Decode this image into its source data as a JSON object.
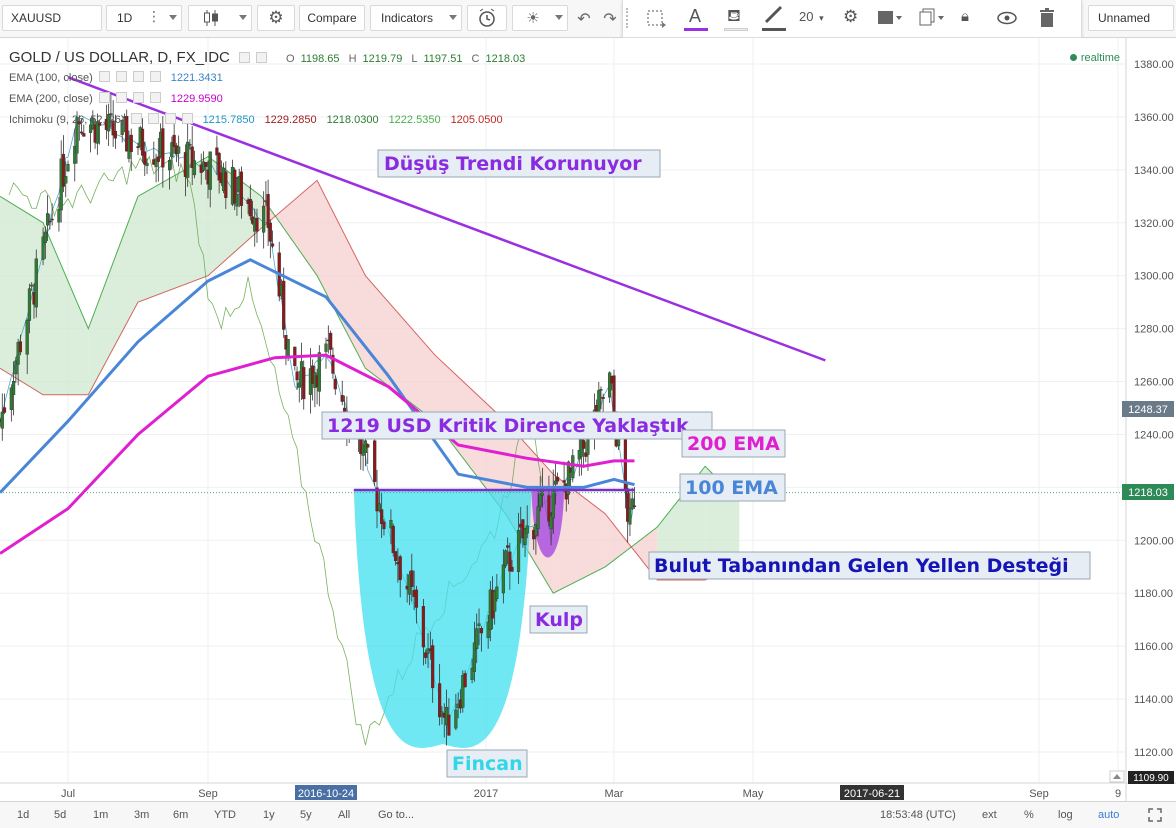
{
  "toolbar": {
    "symbol": "XAUUSD",
    "interval": "1D",
    "compare_label": "Compare",
    "indicators_label": "Indicators",
    "zoom_label": "20",
    "layout_name": "Unnamed"
  },
  "legend": {
    "title": "GOLD / US DOLLAR, D, FX_IDC",
    "ohlc": {
      "o_label": "O",
      "o": "1198.65",
      "h_label": "H",
      "h": "1219.79",
      "l_label": "L",
      "l": "1197.51",
      "c_label": "C",
      "c": "1218.03"
    },
    "realtime": "realtime",
    "indicators": [
      {
        "name": "EMA (100, close)",
        "values": [
          "1221.3431"
        ],
        "colors": [
          "#3d85c6"
        ]
      },
      {
        "name": "EMA (200, close)",
        "values": [
          "1229.9590"
        ],
        "colors": [
          "#cc00cc"
        ]
      },
      {
        "name": "Ichimoku (9, 26, 52, 26)",
        "values": [
          "1215.7850",
          "1229.2850",
          "1218.0300",
          "1222.5350",
          "1205.0500"
        ],
        "colors": [
          "#2196c4",
          "#a31f1f",
          "#2e7d32",
          "#4caf50",
          "#c62828"
        ]
      }
    ]
  },
  "annotations": {
    "trend": "Düşüş Trendi Korunuyor",
    "resistance": "1219 USD Kritik Dirence Yaklaştık",
    "ema200": "200 EMA",
    "ema100": "100 EMA",
    "cloud_support": "Bulut Tabanından Gelen Yellen Desteği",
    "handle": "Kulp",
    "cup": "Fincan"
  },
  "price_axis": {
    "current_price_label": "1218.03",
    "marker_label": "1248.37",
    "bottom_label": "1109.90"
  },
  "time_axis": {
    "highlight_start": "2016-10-24",
    "highlight_end": "2017-06-21"
  },
  "bottombar": {
    "ranges": [
      "1d",
      "5d",
      "1m",
      "3m",
      "6m",
      "YTD",
      "1y",
      "5y",
      "All"
    ],
    "goto": "Go to...",
    "clock": "18:53:48 (UTC)",
    "ext": "ext",
    "percent": "%",
    "log": "log",
    "auto": "auto"
  },
  "colors": {
    "trend_line": "#9b30e0",
    "ema100": "#4a86d8",
    "ema200": "#e020d0",
    "cup_fill": "#40e0ef",
    "handle_fill": "#a040e0",
    "cloud_green": "#cfe8cf",
    "cloud_red": "#f6cfcf",
    "candle_up": "#2e7d32",
    "candle_down": "#8b1a1a"
  },
  "chart_data": {
    "type": "candlestick",
    "title": "GOLD / US DOLLAR, D, FX_IDC",
    "y_ticks": [
      1120,
      1140,
      1160,
      1180,
      1200,
      1220,
      1240,
      1260,
      1280,
      1300,
      1320,
      1340,
      1360,
      1380
    ],
    "ylim": [
      1110,
      1385
    ],
    "x_ticks": [
      "Jul",
      "Sep",
      "2016-10-24",
      "2017",
      "Mar",
      "May",
      "2017-06-21",
      "Sep",
      "9"
    ],
    "grid": true,
    "series": [
      {
        "name": "EMA (100, close)",
        "x": [
          "2016-06-01",
          "2016-07-01",
          "2016-08-01",
          "2016-09-01",
          "2016-09-20",
          "2016-10-24",
          "2016-11-20",
          "2016-12-20",
          "2017-01-20",
          "2017-02-15",
          "2017-03-01",
          "2017-03-10"
        ],
        "values": [
          1218,
          1245,
          1275,
          1298,
          1306,
          1292,
          1262,
          1225,
          1220,
          1220,
          1223,
          1221
        ]
      },
      {
        "name": "EMA (200, close)",
        "x": [
          "2016-06-01",
          "2016-07-01",
          "2016-08-01",
          "2016-09-01",
          "2016-10-01",
          "2016-10-24",
          "2016-11-20",
          "2016-12-20",
          "2017-01-20",
          "2017-02-15",
          "2017-03-01",
          "2017-03-10"
        ],
        "values": [
          1195,
          1212,
          1240,
          1262,
          1269,
          1270,
          1258,
          1236,
          1231,
          1228,
          1230,
          1230
        ]
      },
      {
        "name": "Close",
        "x": [
          "2016-06-01",
          "2016-07-05",
          "2016-08-01",
          "2016-09-05",
          "2016-09-28",
          "2016-10-10",
          "2016-10-25",
          "2016-11-10",
          "2016-12-01",
          "2016-12-15",
          "2017-01-10",
          "2017-01-25",
          "2017-02-10",
          "2017-02-27",
          "2017-03-08",
          "2017-03-10"
        ],
        "values": [
          1245,
          1360,
          1350,
          1340,
          1320,
          1258,
          1270,
          1230,
          1175,
          1130,
          1190,
          1210,
          1225,
          1260,
          1205,
          1218
        ]
      }
    ],
    "annotations": [
      {
        "text": "Düşüş Trendi Korunuyor",
        "kind": "trendline",
        "x": [
          "2016-07-01",
          "2017-06-01"
        ],
        "y": [
          1375,
          1268
        ]
      },
      {
        "text": "1219 USD Kritik Dirence Yaklaştık",
        "kind": "hline",
        "y": 1219
      },
      {
        "text": "Fincan",
        "kind": "cup"
      },
      {
        "text": "Kulp",
        "kind": "handle"
      }
    ]
  }
}
